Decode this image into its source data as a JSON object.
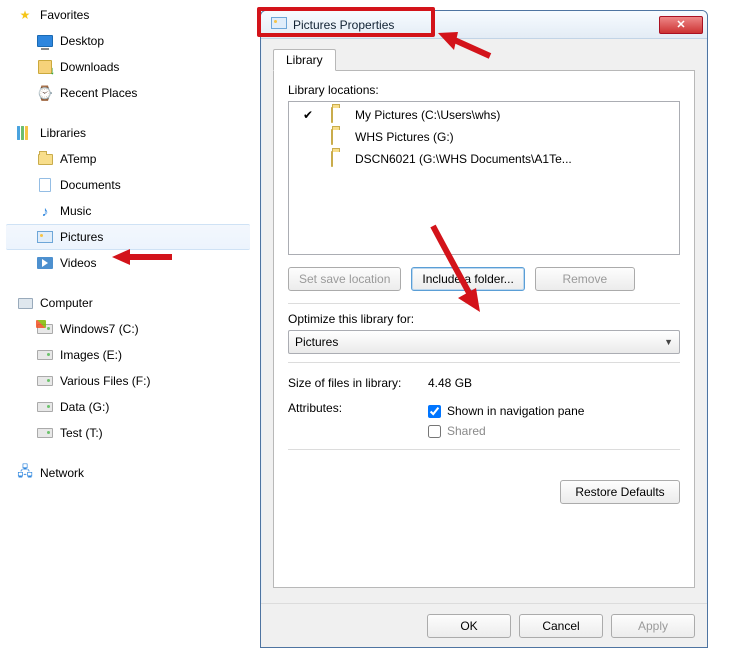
{
  "nav": {
    "favorites": {
      "label": "Favorites",
      "items": [
        {
          "label": "Desktop",
          "icon": "desktop"
        },
        {
          "label": "Downloads",
          "icon": "downloads"
        },
        {
          "label": "Recent Places",
          "icon": "recent"
        }
      ]
    },
    "libraries": {
      "label": "Libraries",
      "items": [
        {
          "label": "ATemp",
          "icon": "folder"
        },
        {
          "label": "Documents",
          "icon": "document"
        },
        {
          "label": "Music",
          "icon": "music"
        },
        {
          "label": "Pictures",
          "icon": "pictures",
          "selected": true
        },
        {
          "label": "Videos",
          "icon": "videos"
        }
      ]
    },
    "computer": {
      "label": "Computer",
      "items": [
        {
          "label": "Windows7 (C:)",
          "icon": "drive-win"
        },
        {
          "label": "Images (E:)",
          "icon": "drive"
        },
        {
          "label": "Various Files (F:)",
          "icon": "drive"
        },
        {
          "label": "Data (G:)",
          "icon": "drive"
        },
        {
          "label": "Test (T:)",
          "icon": "drive"
        }
      ]
    },
    "network": {
      "label": "Network"
    }
  },
  "dialog": {
    "title": "Pictures Properties",
    "tabLabel": "Library",
    "locationsLabel": "Library locations:",
    "locations": [
      {
        "checked": true,
        "label": "My Pictures (C:\\Users\\whs)"
      },
      {
        "checked": false,
        "label": "WHS Pictures (G:)"
      },
      {
        "checked": false,
        "label": "DSCN6021 (G:\\WHS Documents\\A1Te..."
      }
    ],
    "buttons": {
      "setSave": "Set save location",
      "include": "Include a folder...",
      "remove": "Remove"
    },
    "optimizeLabel": "Optimize this library for:",
    "optimizeValue": "Pictures",
    "sizeLabel": "Size of files in library:",
    "sizeValue": "4.48 GB",
    "attributesLabel": "Attributes:",
    "shownLabel": "Shown in navigation pane",
    "sharedLabel": "Shared",
    "restoreLabel": "Restore Defaults",
    "ok": "OK",
    "cancel": "Cancel",
    "apply": "Apply"
  }
}
